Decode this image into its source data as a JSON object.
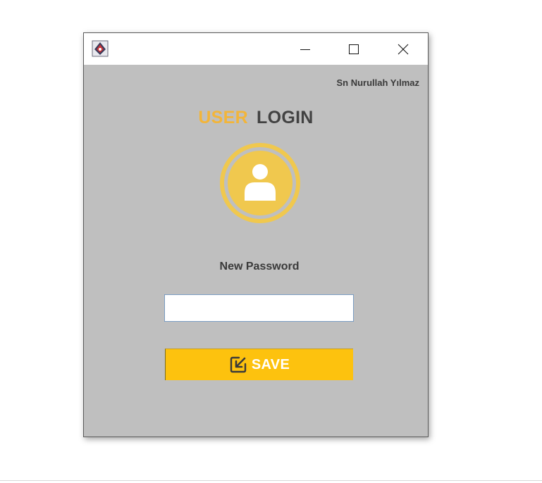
{
  "header": {
    "user_name": "Sn Nurullah Yılmaz"
  },
  "title": {
    "part1": "USER",
    "part2": "LOGIN"
  },
  "form": {
    "password_label": "New Password",
    "password_value": ""
  },
  "save_button": {
    "label": "SAVE",
    "icon": "edit-square-icon"
  },
  "icons": {
    "app": "java-app-icon",
    "minimize": "minimize-icon",
    "maximize": "maximize-icon",
    "close": "close-icon",
    "avatar": "user-avatar-icon"
  },
  "colors": {
    "background": "#bfbfbf",
    "accent": "#fdc20e",
    "avatar": "#f0c84e",
    "title_user": "#f2b53a",
    "title_login": "#424242"
  }
}
